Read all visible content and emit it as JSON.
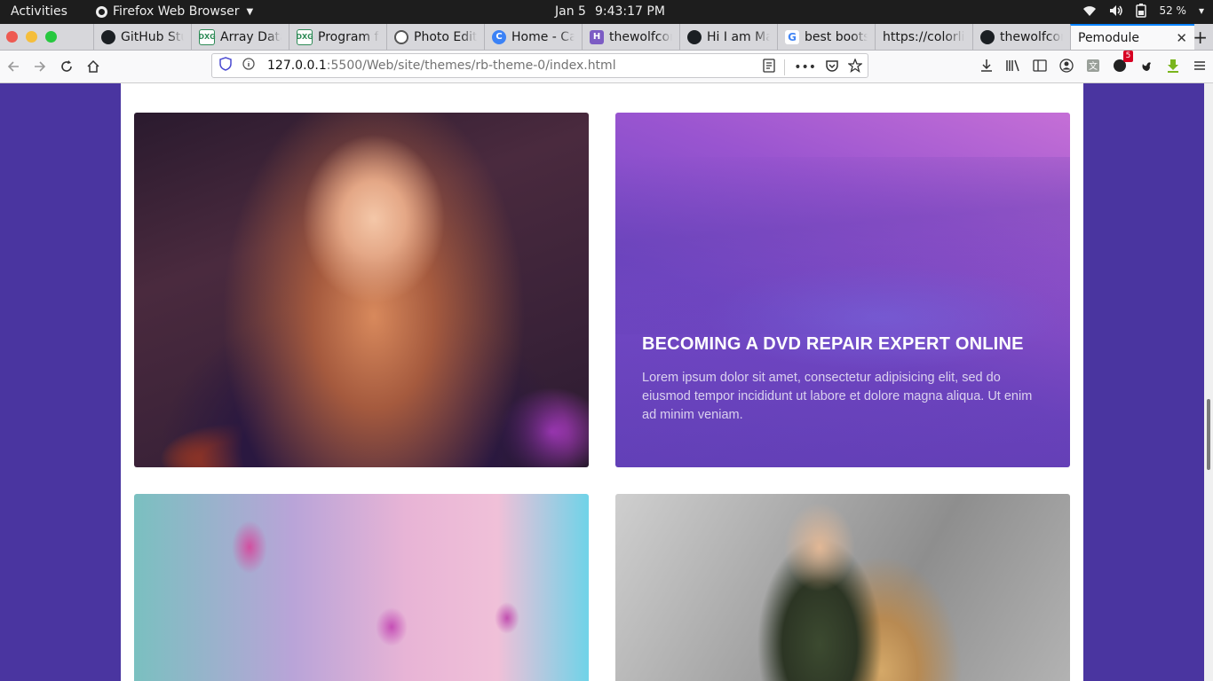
{
  "system_bar": {
    "activities": "Activities",
    "app_name": "Firefox Web Browser",
    "date": "Jan 5",
    "time": "9:43:17 PM",
    "battery": "52 %"
  },
  "tabs": [
    {
      "label": "GitHub Stu",
      "icon": "github-icon"
    },
    {
      "label": "Array Data",
      "icon": "dxg-icon"
    },
    {
      "label": "Program fo",
      "icon": "dxg-icon"
    },
    {
      "label": "Photo Edit",
      "icon": "photo-icon"
    },
    {
      "label": "Home - Ca",
      "icon": "canva-icon"
    },
    {
      "label": "thewolfcon",
      "icon": "hashnode-icon"
    },
    {
      "label": "Hi I am Ma",
      "icon": "github-icon"
    },
    {
      "label": "best boots",
      "icon": "google-icon"
    },
    {
      "label": "https://colorlib",
      "icon": "none"
    },
    {
      "label": "thewolfcon",
      "icon": "github-icon"
    }
  ],
  "active_tab": {
    "label": "Pemodule"
  },
  "url": {
    "host": "127.0.0.1",
    "path": ":5500/Web/site/themes/rb-theme-0/index.html"
  },
  "toolbar": {
    "badge_count": "5"
  },
  "cards": {
    "coast": {
      "title": "BECOMING A DVD REPAIR EXPERT ONLINE",
      "body": "Lorem ipsum dolor sit amet, consectetur adipisicing elit, sed do eiusmod tempor incididunt ut labore et dolore magna aliqua. Ut enim ad minim veniam."
    }
  },
  "colors": {
    "page_background": "#4a35a0",
    "accent_tab": "#0a84ff",
    "card_overlay": "#7448c6"
  }
}
